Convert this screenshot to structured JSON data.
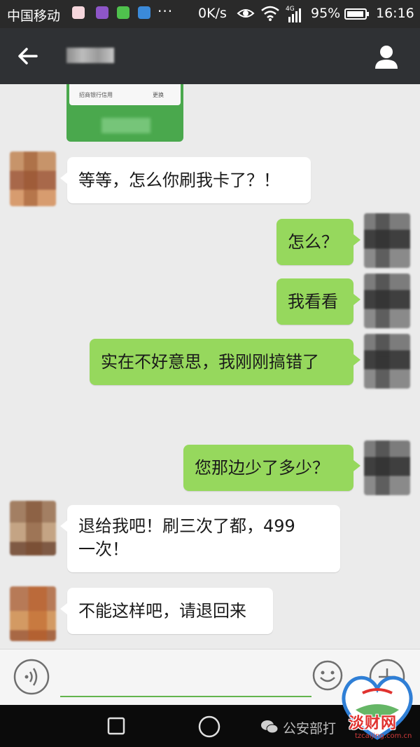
{
  "status_bar": {
    "carrier": "中国移动",
    "network_speed": "0K/s",
    "signal_label": "4G",
    "battery_percent": "95%",
    "battery_level": 0.95,
    "time": "16:16",
    "notification_icons": [
      "calendar-icon",
      "mail-icon",
      "wechat-icon",
      "app-icon"
    ],
    "overflow": "···"
  },
  "title_bar": {
    "contact_name": "blurred",
    "back_icon": "back-arrow-icon",
    "profile_icon": "person-icon"
  },
  "card": {
    "bank_name": "招商银行信用",
    "change_label": "更换"
  },
  "messages": [
    {
      "side": "in",
      "text": "等等，怎么你刷我卡了？！"
    },
    {
      "side": "out",
      "text": "怎么？"
    },
    {
      "side": "out",
      "text": "我看看"
    },
    {
      "side": "out",
      "text": "实在不好意思，我刚刚搞错了"
    },
    {
      "side": "out",
      "text": "您那边少了多少？"
    },
    {
      "side": "in",
      "line1": "退给我吧！刷三次了都，499",
      "line2": "一次！"
    },
    {
      "side": "in",
      "text": "不能这样吧，请退回来"
    }
  ],
  "input_bar": {
    "voice_icon": "voice-icon",
    "emoji_icon": "emoji-icon",
    "plus_icon": "plus-icon",
    "value": ""
  },
  "nav_bar": {
    "watermark": "公安部打"
  },
  "logo": {
    "text": "淡财网",
    "url": "tzcaijing.com.cn"
  },
  "colors": {
    "outgoing_bubble": "#96d85d",
    "incoming_bubble": "#ffffff",
    "chat_background": "#ebebeb",
    "title_bar": "#2f3134",
    "status_bar": "#2a2a2a"
  }
}
